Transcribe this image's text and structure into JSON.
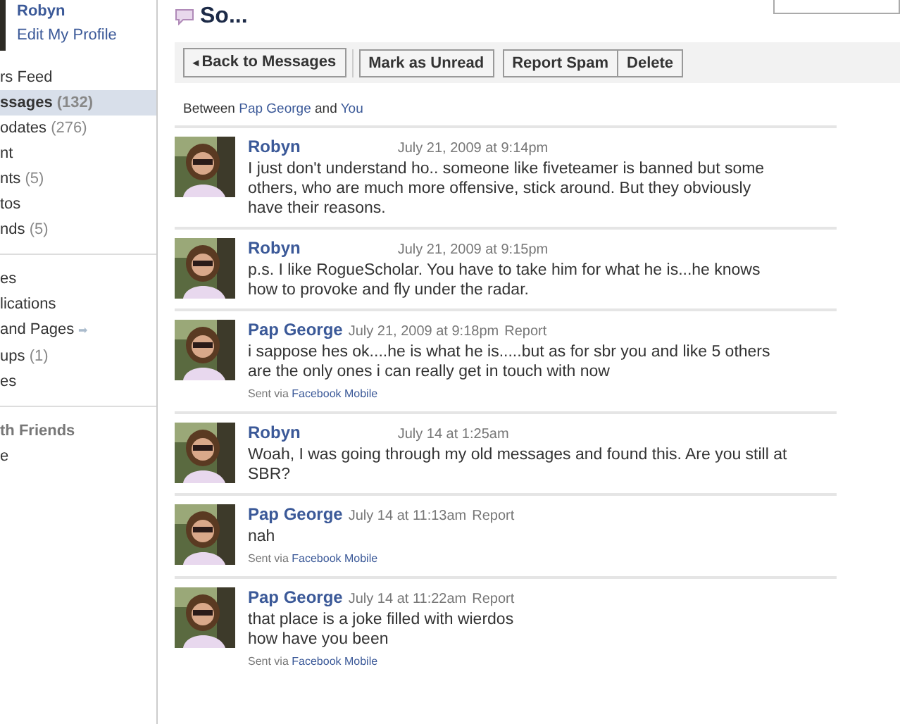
{
  "sidebar": {
    "profile": {
      "name": "Robyn",
      "edit_link": "Edit My Profile"
    },
    "groups": [
      {
        "items": [
          {
            "label": "rs Feed",
            "selected": false
          },
          {
            "label": "ssages",
            "count": "(132)",
            "selected": true
          },
          {
            "label": "odates",
            "count": "(276)",
            "selected": false
          },
          {
            "label": "nt",
            "selected": false
          },
          {
            "label": "nts",
            "count": "(5)",
            "selected": false
          },
          {
            "label": "tos",
            "selected": false
          },
          {
            "label": "nds",
            "count": "(5)",
            "selected": false
          }
        ]
      },
      {
        "items": [
          {
            "label": "es",
            "selected": false
          },
          {
            "label": "lications",
            "selected": false
          },
          {
            "label": "and Pages",
            "arrow": "➡",
            "selected": false
          },
          {
            "label": "ups",
            "count": "(1)",
            "selected": false
          },
          {
            "label": "es",
            "selected": false
          }
        ]
      },
      {
        "heading": "th Friends",
        "items": [
          {
            "label": "e",
            "selected": false
          }
        ]
      }
    ]
  },
  "thread": {
    "title": "So...",
    "toolbar": [
      {
        "label": "Back to Messages",
        "arrow": "◂"
      },
      {
        "label": "Mark as Unread"
      },
      {
        "label": "Report Spam"
      },
      {
        "label": "Delete"
      }
    ],
    "between": {
      "prefix": "Between",
      "person": "Pap George",
      "joiner": "and",
      "you": "You"
    },
    "messages": [
      {
        "author": "Robyn",
        "time": "July 21, 2009 at 9:14pm",
        "body": "I just don't understand ho.. someone like fiveteamer is banned but some others, who are much more offensive, stick around. But they obviously have their reasons."
      },
      {
        "author": "Robyn",
        "time": "July 21, 2009 at 9:15pm",
        "body": "p.s. I like RogueScholar. You have to take him for what he is...he knows how to provoke and fly under the radar."
      },
      {
        "author": "Pap George",
        "time": "July 21, 2009 at 9:18pm",
        "report": "Report",
        "body": "i sappose hes ok....he is what he is.....but as for sbr you and like 5 others are the only ones i can really get in touch with now",
        "sent_via": {
          "prefix": "Sent via",
          "link": "Facebook Mobile"
        }
      },
      {
        "author": "Robyn",
        "time": "July 14 at 1:25am",
        "body": "Woah, I was going through my old messages and found this. Are you still at SBR?"
      },
      {
        "author": "Pap George",
        "time": "July 14 at 11:13am",
        "report": "Report",
        "body": "nah",
        "sent_via": {
          "prefix": "Sent via",
          "link": "Facebook Mobile"
        }
      },
      {
        "author": "Pap George",
        "time": "July 14 at 11:22am",
        "report": "Report",
        "body": "that place is a joke filled with wierdos\nhow have you been",
        "sent_via": {
          "prefix": "Sent via",
          "link": "Facebook Mobile"
        }
      }
    ]
  }
}
